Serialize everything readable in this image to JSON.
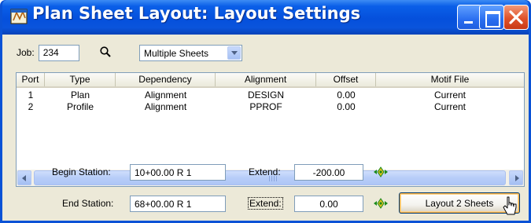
{
  "window": {
    "title": "Plan Sheet Layout: Layout Settings"
  },
  "job": {
    "label": "Job:",
    "value": "234",
    "sheet_mode": "Multiple Sheets"
  },
  "table": {
    "columns": [
      "Port",
      "Type",
      "Dependency",
      "Alignment",
      "Offset",
      "Motif File"
    ],
    "rows": [
      [
        "1",
        "Plan",
        "Alignment",
        "DESIGN",
        "0.00",
        "Current"
      ],
      [
        "2",
        "Profile",
        "Alignment",
        "PPROF",
        "0.00",
        "Current"
      ]
    ]
  },
  "stations": {
    "begin_label": "Begin Station:",
    "begin_value": "10+00.00 R 1",
    "end_label": "End Station:",
    "end_value": "68+00.00 R 1",
    "extend_label": "Extend:",
    "begin_extend": "-200.00",
    "end_extend": "0.00"
  },
  "buttons": {
    "layout": "Layout 2 Sheets"
  }
}
